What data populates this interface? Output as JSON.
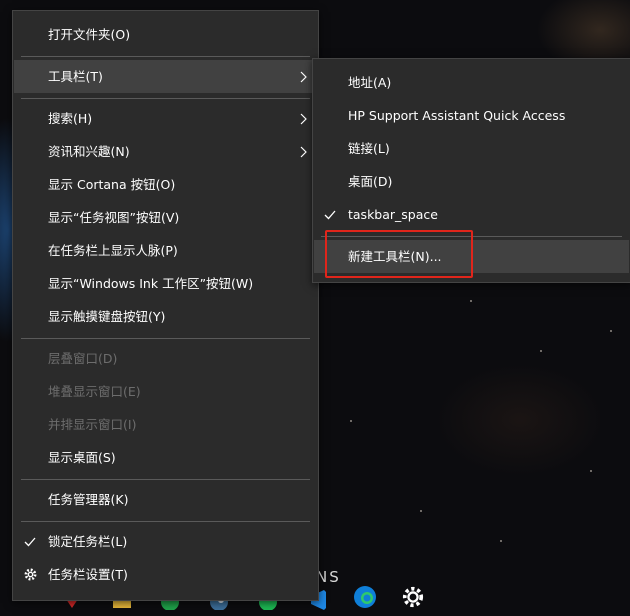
{
  "context_menu": {
    "items": [
      {
        "label": "打开文件夹(O)"
      },
      {
        "label": "工具栏(T)"
      },
      {
        "label": "搜索(H)"
      },
      {
        "label": "资讯和兴趣(N)"
      },
      {
        "label": "显示 Cortana 按钮(O)"
      },
      {
        "label": "显示“任务视图”按钮(V)"
      },
      {
        "label": "在任务栏上显示人脉(P)"
      },
      {
        "label": "显示“Windows Ink 工作区”按钮(W)"
      },
      {
        "label": "显示触摸键盘按钮(Y)"
      },
      {
        "label": "层叠窗口(D)"
      },
      {
        "label": "堆叠显示窗口(E)"
      },
      {
        "label": "并排显示窗口(I)"
      },
      {
        "label": "显示桌面(S)"
      },
      {
        "label": "任务管理器(K)"
      },
      {
        "label": "锁定任务栏(L)"
      },
      {
        "label": "任务栏设置(T)"
      }
    ]
  },
  "toolbar_submenu": {
    "items": [
      {
        "label": "地址(A)"
      },
      {
        "label": "HP Support Assistant Quick Access"
      },
      {
        "label": "链接(L)"
      },
      {
        "label": "桌面(D)"
      },
      {
        "label": "taskbar_space"
      },
      {
        "label": "新建工具栏(N)..."
      }
    ]
  },
  "desktop": {
    "wallpaper_text": "NS"
  },
  "icons": [
    "chevron-right-icon",
    "check-icon",
    "gear-icon"
  ],
  "colors": {
    "menu_bg": "#2b2b2b",
    "hover_bg": "#414141",
    "highlight_border": "#e0251b",
    "disabled_text": "#6d6d6d"
  }
}
